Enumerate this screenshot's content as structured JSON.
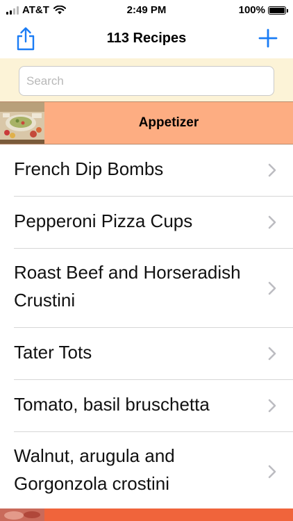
{
  "status_bar": {
    "carrier": "AT&T",
    "time": "2:49 PM",
    "battery": "100%"
  },
  "nav": {
    "title": "113 Recipes",
    "share_icon": "share-icon",
    "add_icon": "plus-icon"
  },
  "search": {
    "placeholder": "Search",
    "value": ""
  },
  "section": {
    "title": "Appetizer",
    "color": "#fdad82"
  },
  "recipes": [
    {
      "label": "French Dip Bombs"
    },
    {
      "label": "Pepperoni Pizza Cups"
    },
    {
      "label": "Roast Beef and Horseradish Crustini"
    },
    {
      "label": "Tater Tots"
    },
    {
      "label": "Tomato, basil bruschetta"
    },
    {
      "label": "Walnut, arugula and Gorgonzola crostini"
    }
  ],
  "colors": {
    "accent": "#1a7cf5",
    "search_background": "#fcf3d7",
    "next_section": "#f0643b"
  }
}
